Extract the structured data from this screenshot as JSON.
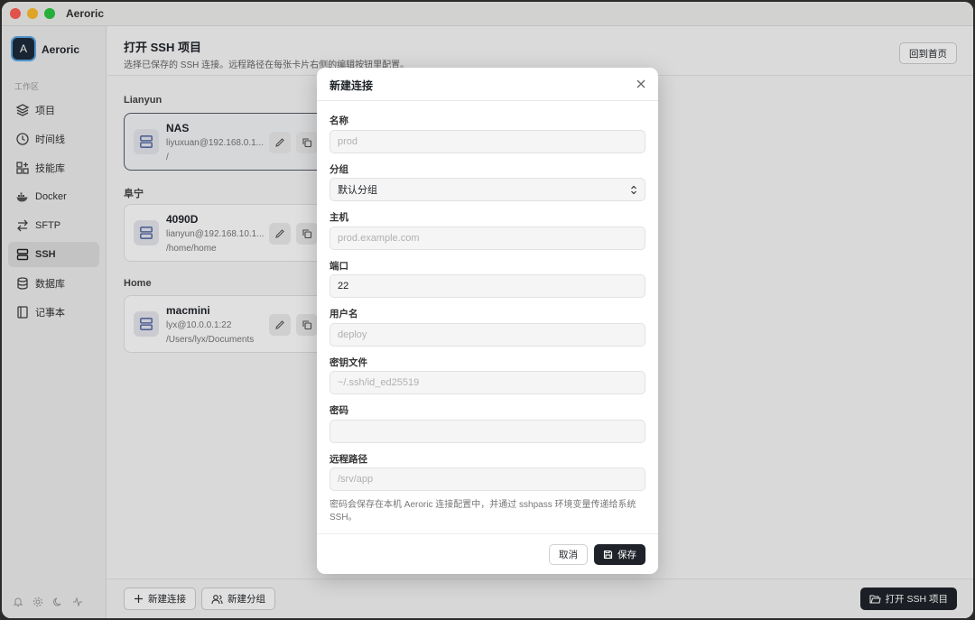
{
  "window": {
    "title": "Aeroric"
  },
  "sidebar": {
    "brand": {
      "logo_letter": "A",
      "name": "Aeroric"
    },
    "section_label": "工作区",
    "items": [
      {
        "label": "项目",
        "icon": "layers-icon"
      },
      {
        "label": "时间线",
        "icon": "clock-icon"
      },
      {
        "label": "技能库",
        "icon": "grid-plus-icon"
      },
      {
        "label": "Docker",
        "icon": "docker-icon"
      },
      {
        "label": "SFTP",
        "icon": "transfer-icon"
      },
      {
        "label": "SSH",
        "icon": "server-icon",
        "active": true
      },
      {
        "label": "数据库",
        "icon": "database-icon"
      },
      {
        "label": "记事本",
        "icon": "notebook-icon"
      }
    ],
    "footer_icons": [
      "bell-icon",
      "settings-icon",
      "moon-icon",
      "activity-icon"
    ]
  },
  "header": {
    "title": "打开 SSH 项目",
    "subtitle": "选择已保存的 SSH 连接。远程路径在每张卡片右侧的编辑按钮里配置。",
    "home_button": "回到首页"
  },
  "groups": [
    {
      "name": "Lianyun",
      "connections": [
        {
          "name": "NAS",
          "host": "liyuxuan@192.168.0.1...",
          "path": "/",
          "selected": true
        }
      ]
    },
    {
      "name": "阜宁",
      "connections": [
        {
          "name": "4090D",
          "host": "lianyun@192.168.10.1...",
          "path": "/home/home"
        }
      ]
    },
    {
      "name": "Home",
      "connections": [
        {
          "name": "macmini",
          "host": "lyx@10.0.0.1:22",
          "path": "/Users/lyx/Documents"
        }
      ]
    }
  ],
  "footer": {
    "new_connection": "新建连接",
    "new_group": "新建分组",
    "open_project": "打开 SSH 项目"
  },
  "modal": {
    "title": "新建连接",
    "fields": {
      "name": {
        "label": "名称",
        "placeholder": "prod",
        "value": ""
      },
      "group": {
        "label": "分组",
        "value": "默认分组"
      },
      "host": {
        "label": "主机",
        "placeholder": "prod.example.com",
        "value": ""
      },
      "port": {
        "label": "端口",
        "value": "22"
      },
      "username": {
        "label": "用户名",
        "placeholder": "deploy",
        "value": ""
      },
      "key_file": {
        "label": "密钥文件",
        "placeholder": "~/.ssh/id_ed25519",
        "value": ""
      },
      "password": {
        "label": "密码",
        "value": ""
      },
      "remote_path": {
        "label": "远程路径",
        "placeholder": "/srv/app",
        "value": ""
      }
    },
    "note": "密码会保存在本机 Aeroric 连接配置中，并通过 sshpass 环境变量传递给系统 SSH。",
    "cancel": "取消",
    "save": "保存"
  }
}
